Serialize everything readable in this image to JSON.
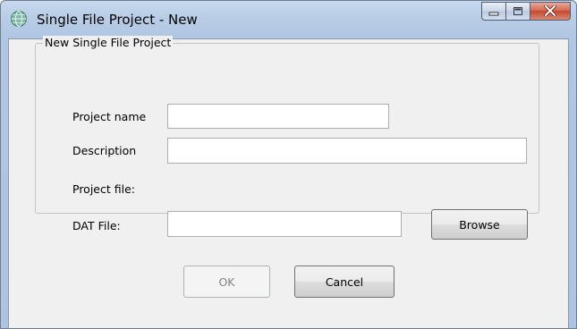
{
  "window": {
    "title": "Single File Project - New"
  },
  "group": {
    "legend": "New Single File Project"
  },
  "form": {
    "project_name_label": "Project name",
    "project_name_value": "",
    "description_label": "Description",
    "description_value": "",
    "project_file_label": "Project file:",
    "dat_file_label": "DAT File:",
    "dat_file_value": "",
    "browse_label": "Browse"
  },
  "buttons": {
    "ok_label": "OK",
    "cancel_label": "Cancel"
  },
  "icons": {
    "app": "globe-icon",
    "minimize": "minimize-icon",
    "maximize": "maximize-icon",
    "close": "close-icon"
  },
  "colors": {
    "title_bar": "#b9cde6",
    "close_button": "#c24a30",
    "client_bg": "#f0f0f0"
  }
}
